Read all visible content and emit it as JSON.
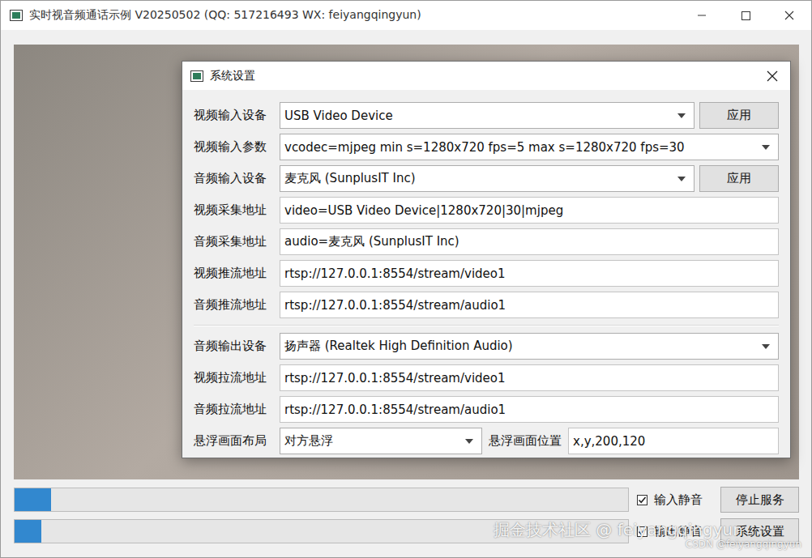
{
  "window": {
    "title": "实时视音频通话示例 V20250502 (QQ: 517216493 WX: feiyangqingyun)"
  },
  "video": {
    "kind": "video-frame"
  },
  "dialog": {
    "title": "系统设置",
    "groups": [
      [
        {
          "label": "视频输入设备",
          "kind": "combo",
          "value": "USB Video Device",
          "button": "应用"
        },
        {
          "label": "视频输入参数",
          "kind": "combo",
          "value": "vcodec=mjpeg min s=1280x720 fps=5 max s=1280x720 fps=30"
        },
        {
          "label": "音频输入设备",
          "kind": "combo",
          "value": "麦克风 (SunplusIT Inc)",
          "button": "应用"
        },
        {
          "label": "视频采集地址",
          "kind": "field",
          "value": "video=USB Video Device|1280x720|30|mjpeg"
        },
        {
          "label": "音频采集地址",
          "kind": "field",
          "value": "audio=麦克风 (SunplusIT Inc)"
        },
        {
          "label": "视频推流地址",
          "kind": "field",
          "value": "rtsp://127.0.0.1:8554/stream/video1"
        },
        {
          "label": "音频推流地址",
          "kind": "field",
          "value": "rtsp://127.0.0.1:8554/stream/audio1"
        }
      ],
      [
        {
          "label": "音频输出设备",
          "kind": "combo",
          "value": "扬声器 (Realtek High Definition Audio)"
        },
        {
          "label": "视频拉流地址",
          "kind": "field",
          "value": "rtsp://127.0.0.1:8554/stream/video1"
        },
        {
          "label": "音频拉流地址",
          "kind": "field",
          "value": "rtsp://127.0.0.1:8554/stream/audio1"
        },
        {
          "label": "悬浮画面布局",
          "kind": "combo-field",
          "value": "对方悬浮",
          "label2": "悬浮画面位置",
          "value2": "x,y,200,120"
        }
      ]
    ]
  },
  "controls": [
    {
      "level": 0.06,
      "checkbox": {
        "label": "输入静音",
        "checked": true
      },
      "button": "停止服务"
    },
    {
      "level": 0.043,
      "checkbox": {
        "label": "输出静音",
        "checked": true
      },
      "button": "系统设置"
    }
  ],
  "watermarks": [
    "掘金技术社区 @ feiyangqingyun",
    "CSDN @feiyangqingyun"
  ]
}
